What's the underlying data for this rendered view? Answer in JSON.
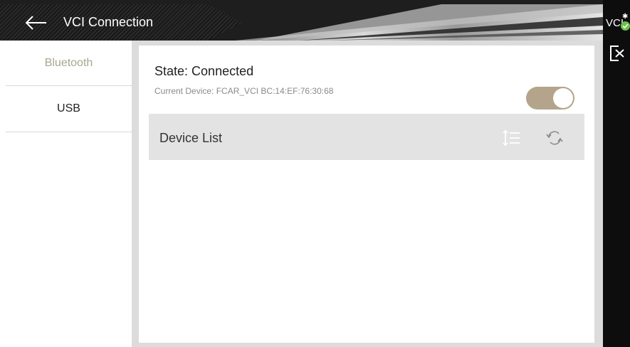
{
  "header": {
    "title": "VCI Connection",
    "back_icon": "arrow-left-icon"
  },
  "vci_status": {
    "label": "VCI",
    "bluetooth_icon": "bluetooth-icon",
    "status_icon": "connected-check-icon",
    "status_color": "#6cc04a"
  },
  "sidebar": {
    "items": [
      {
        "label": "Bluetooth",
        "active": true
      },
      {
        "label": "USB",
        "active": false
      }
    ],
    "active_color": "#a8a590"
  },
  "connection": {
    "state_label": "State:",
    "state_value": "Connected",
    "device_label": "Current Device:",
    "device_value": "FCAR_VCI BC:14:EF:76:30:68",
    "toggle_on": true,
    "toggle_color": "#b3a48b"
  },
  "device_list": {
    "title": "Device List",
    "sort_icon": "sort-icon",
    "refresh_icon": "refresh-icon",
    "items": []
  },
  "exit_icon": "exit-icon"
}
